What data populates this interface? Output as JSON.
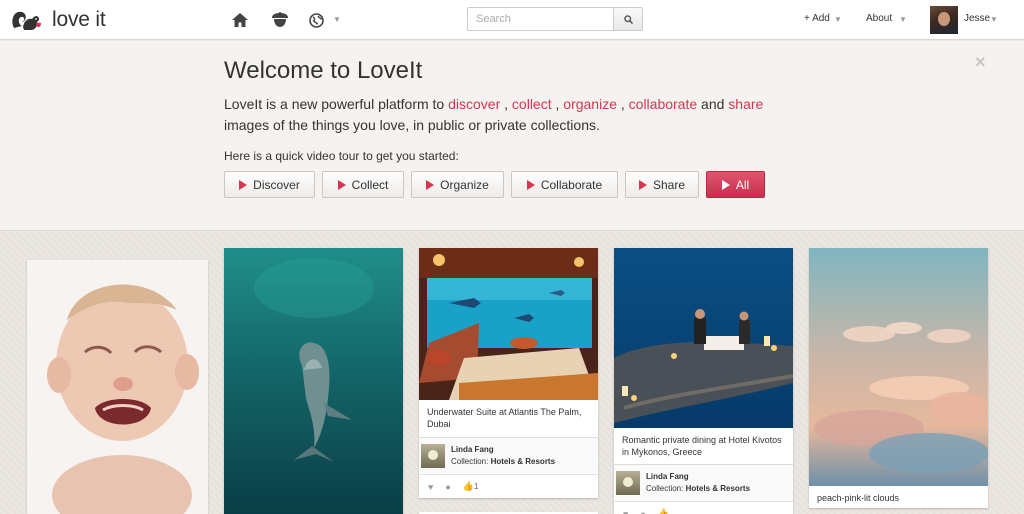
{
  "header": {
    "logo_text": "love it",
    "search_placeholder": "Search",
    "add_label": "+ Add",
    "about_label": "About",
    "user_name": "Jesse"
  },
  "welcome": {
    "title": "Welcome to LoveIt",
    "intro_start": "LoveIt is a new powerful platform to ",
    "kw_discover": "discover",
    "kw_collect": "collect",
    "kw_organize": "organize",
    "kw_collaborate": "collaborate",
    "sep_comma": " , ",
    "sep_and": " and ",
    "kw_share": "share",
    "intro_end": "images of the things you love, in public or private collections.",
    "tour_text": "Here is a quick video tour to get you started:",
    "close": "×",
    "buttons": [
      "Discover",
      "Collect",
      "Organize",
      "Collaborate",
      "Share",
      "All"
    ]
  },
  "feed": {
    "cards": [
      {
        "caption": ""
      },
      {
        "caption": ""
      },
      {
        "caption": "Underwater Suite at Atlantis The Palm, Dubai",
        "user": "Linda Fang",
        "collection_label": "Collection: ",
        "collection": "Hotels & Resorts",
        "likes": "1"
      },
      {
        "caption": "Romantic private dining at Hotel Kivotos in Mykonos, Greece",
        "user": "Linda Fang",
        "collection_label": "Collection: ",
        "collection": "Hotels & Resorts"
      },
      {
        "caption": "peach-pink-lit clouds"
      }
    ]
  },
  "colors": {
    "accent": "#d8334f",
    "link": "#d03855"
  }
}
